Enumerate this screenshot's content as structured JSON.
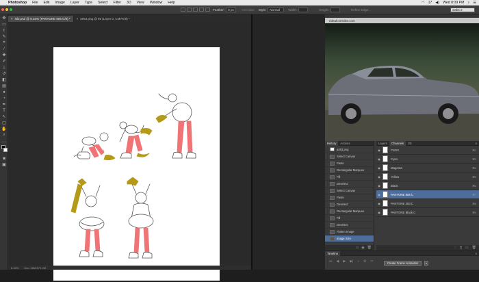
{
  "menubar": {
    "apple": "",
    "app": "Photoshop",
    "items": [
      "File",
      "Edit",
      "Image",
      "Layer",
      "Type",
      "Select",
      "Filter",
      "3D",
      "View",
      "Window",
      "Help"
    ],
    "clock": "Wed 8:09 PM",
    "wifi": "17"
  },
  "options": {
    "feather_label": "Feather:",
    "feather_value": "0 px",
    "antialias": "Anti-alias",
    "style_label": "Style:",
    "style_value": "Normal",
    "width_label": "Width:",
    "height_label": "Height:",
    "refine": "Refine Edge...",
    "workspace": "webs 2"
  },
  "doctabs": [
    {
      "label": "lol2.psd @ 8.33% (PANTONE 805 C/8) *",
      "active": true
    },
    {
      "label": "a063.png @ 86 (Layer 0, CMYK/8) *",
      "active": false
    }
  ],
  "status": {
    "zoom": "8.33%",
    "doc": "Doc: 28M/171.0M"
  },
  "photo": {
    "url": "ridealt.netvibe.com"
  },
  "history": {
    "tabs": [
      "History",
      "Actions"
    ],
    "snapshot": "a063.png",
    "items": [
      "Select Canvas",
      "Paste",
      "Rectangular Marquee",
      "Fill",
      "Deselect",
      "Select Canvas",
      "Paste",
      "Deselect",
      "Rectangular Marquee",
      "Fill",
      "Deselect",
      "Flatten Image",
      "Image Size"
    ]
  },
  "channels": {
    "tabs": [
      "Layers",
      "Channels",
      "3D"
    ],
    "rows": [
      {
        "name": "CMYK",
        "key": "⌘2"
      },
      {
        "name": "Cyan",
        "key": "⌘3"
      },
      {
        "name": "Magenta",
        "key": "⌘4"
      },
      {
        "name": "Yellow",
        "key": "⌘5"
      },
      {
        "name": "Black",
        "key": "⌘6"
      },
      {
        "name": "PANTONE 805 C",
        "key": "⌘7"
      },
      {
        "name": "PANTONE 283 C",
        "key": "⌘8"
      },
      {
        "name": "PANTONE Black C",
        "key": "⌘9"
      }
    ]
  },
  "timeline": {
    "title": "Timeline",
    "button": "Create Frame Animation"
  },
  "colors": {
    "pink": "#f07475",
    "mustard": "#b49a18",
    "selection": "#4d6d9a"
  }
}
